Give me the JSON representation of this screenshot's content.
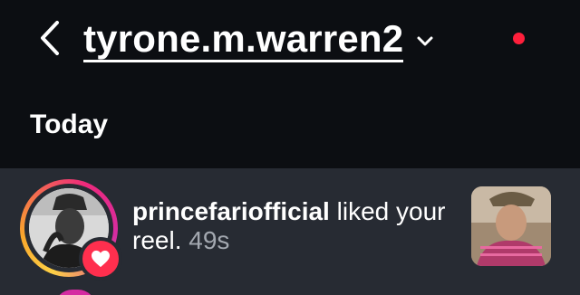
{
  "header": {
    "account_title": "tyrone.m.warren2",
    "back_icon": "chevron-left-icon",
    "dropdown_icon": "chevron-down-icon",
    "has_unread_dot": true
  },
  "sections": [
    {
      "label": "Today",
      "items": [
        {
          "username": "princefariofficial",
          "action": "liked your reel.",
          "time": "49s",
          "badge_icon": "heart-icon",
          "thumbnail": "reel-thumbnail"
        }
      ]
    }
  ],
  "colors": {
    "background": "#0c0e12",
    "row_background": "#272b33",
    "notification_dot": "#ff1f3b",
    "heart_badge": "#ff2f4e",
    "secondary_text": "#a3a8b0"
  }
}
